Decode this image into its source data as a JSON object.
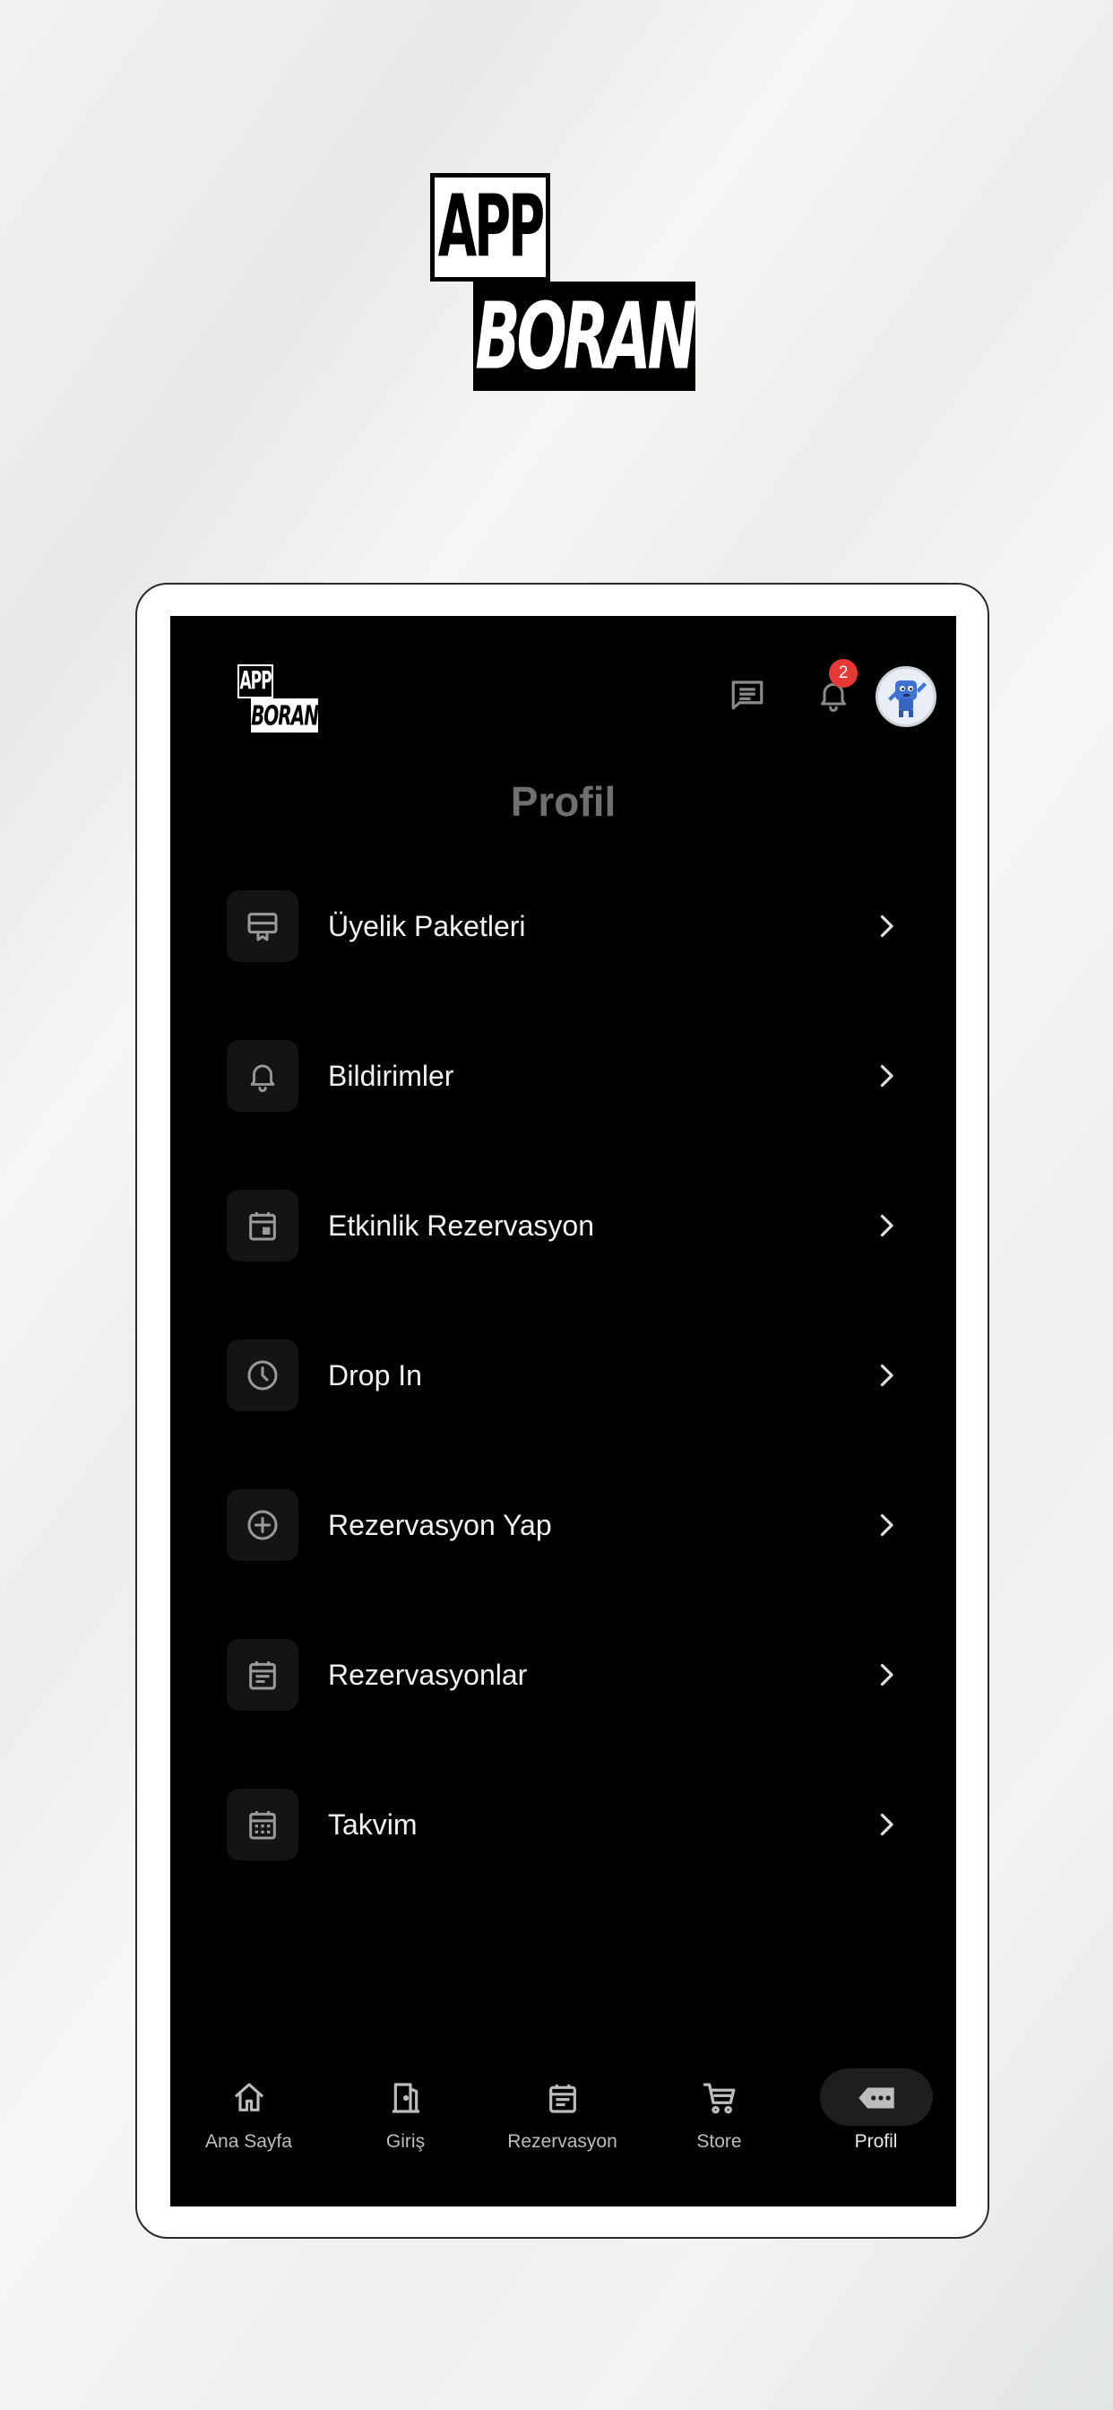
{
  "brand": {
    "logo_line1": "APP",
    "logo_line2": "BORAN"
  },
  "header": {
    "notification_count": "2",
    "title": "Profil"
  },
  "menu": [
    {
      "label": "Üyelik Paketleri",
      "icon": "membership-card-icon"
    },
    {
      "label": "Bildirimler",
      "icon": "bell-icon"
    },
    {
      "label": "Etkinlik Rezervasyon",
      "icon": "event-calendar-icon"
    },
    {
      "label": "Drop In",
      "icon": "clock-icon"
    },
    {
      "label": "Rezervasyon Yap",
      "icon": "add-circle-icon"
    },
    {
      "label": "Rezervasyonlar",
      "icon": "list-calendar-icon"
    },
    {
      "label": "Takvim",
      "icon": "calendar-grid-icon"
    }
  ],
  "bottom_nav": [
    {
      "label": "Ana Sayfa",
      "icon": "home-icon"
    },
    {
      "label": "Giriş",
      "icon": "door-icon"
    },
    {
      "label": "Rezervasyon",
      "icon": "reservation-icon"
    },
    {
      "label": "Store",
      "icon": "cart-icon"
    },
    {
      "label": "Profil",
      "icon": "profile-tag-icon",
      "active": true
    }
  ],
  "colors": {
    "badge": "#e53935",
    "screen_bg": "#000000",
    "tile_bg": "#141414",
    "title_gray": "#6f6f6f"
  }
}
